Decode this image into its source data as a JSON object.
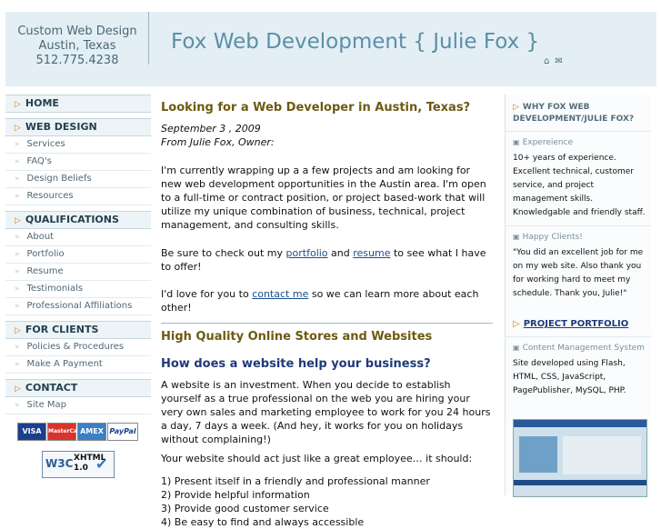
{
  "header": {
    "contact": [
      "Custom Web Design",
      "Austin, Texas",
      "512.775.4238"
    ],
    "title": "Fox Web Development   { Julie Fox }",
    "icons": [
      "home-icon",
      "mail-icon"
    ]
  },
  "nav": {
    "sections": [
      {
        "label": "HOME",
        "items": []
      },
      {
        "label": "WEB DESIGN",
        "items": [
          "Services",
          "FAQ's",
          "Design Beliefs",
          "Resources"
        ]
      },
      {
        "label": "QUALIFICATIONS",
        "items": [
          "About",
          "Portfolio",
          "Resume",
          "Testimonials",
          "Professional Affiliations"
        ]
      },
      {
        "label": "FOR CLIENTS",
        "items": [
          "Policies & Procedures",
          "Make A Payment"
        ]
      },
      {
        "label": "CONTACT",
        "items": [
          "Site Map"
        ]
      }
    ],
    "badges": [
      "VISA",
      "MasterCard",
      "AMEX",
      "PayPal"
    ],
    "w3c": {
      "logo": "W3C",
      "line1": "XHTML",
      "line2": "1.0"
    }
  },
  "main": {
    "heading": "Looking for a Web Developer in Austin, Texas?",
    "date": "September 3 , 2009",
    "from": "From Julie Fox, Owner:",
    "p1": "I'm currently wrapping up a a few projects and am looking for new web development opportunities in the Austin area. I'm open to a full-time or contract position, or project based-work that will utilize my unique combination of business, technical, project management, and consulting skills.",
    "p2_pre": "Be sure to check out my ",
    "p2_link1": "portfolio",
    "p2_mid": " and ",
    "p2_link2": "resume",
    "p2_post": " to see what I have to offer!",
    "p3_pre": "I'd love for you to ",
    "p3_link": "contact me",
    "p3_post": " so we can learn more about each other!",
    "heading2": "High Quality Online Stores and Websites",
    "heading3": "How does a website help your business?",
    "p4": "A website is an investment. When you decide to establish yourself as a true professional on the web you are hiring your very own sales and marketing employee to work for you 24 hours a day, 7 days a week. (And hey, it works for you on holidays without complaining!)",
    "p5": "Your website should act just like a great employee… it should:",
    "list": [
      "1) Present itself in a friendly and professional manner",
      "2) Provide helpful information",
      "3) Provide good customer service",
      "4) Be easy to find and always accessible"
    ]
  },
  "right": {
    "heading": "WHY FOX WEB DEVELOPMENT/JULIE FOX?",
    "s1_title": "Expereience",
    "s1_text": "10+ years of experience. Excellent technical, customer service, and project management skills. Knowledgable and friendly staff.",
    "s2_title": "Happy Clients!",
    "s2_text": "\"You did an excellent job for me on my web site. Also thank you for working hard to meet my schedule. Thank you, Julie!\"",
    "link": "PROJECT PORTFOLIO",
    "s3_title": "Content Management System",
    "s3_text": "Site developed using Flash, HTML, CSS, JavaScript, PagePublisher, MySQL, PHP."
  }
}
